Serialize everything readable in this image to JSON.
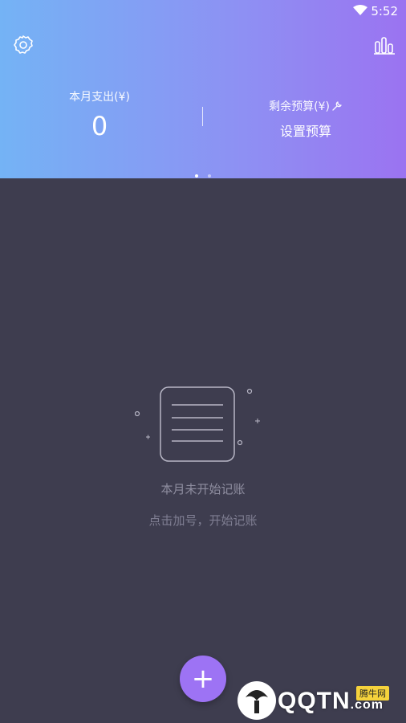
{
  "status_bar": {
    "time": "5:52"
  },
  "header": {
    "icons": {
      "settings": "gear-icon",
      "stats": "bar-chart-icon"
    },
    "monthly_expense": {
      "label": "本月支出(¥)",
      "value": "0"
    },
    "remaining_budget": {
      "label": "剩余预算(¥)",
      "action_label": "设置预算"
    }
  },
  "pager": {
    "count": 2,
    "active_index": 0
  },
  "empty_state": {
    "title": "本月未开始记账",
    "subtitle": "点击加号，开始记账"
  },
  "fab": {
    "label": "+"
  },
  "watermark": {
    "brand": "QQTN",
    "suffix": ".com",
    "tag": "腾牛网"
  },
  "colors": {
    "header_start": "#74b3f5",
    "header_end": "#9b73f1",
    "background": "#3e3d4f",
    "fab": "#9d73f4"
  }
}
